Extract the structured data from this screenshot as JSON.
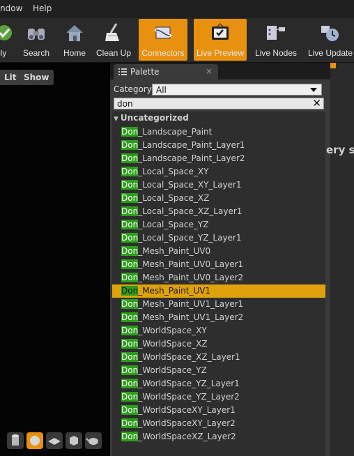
{
  "menu": {
    "items": [
      "ndow",
      "Help"
    ]
  },
  "toolbar": {
    "buttons": [
      {
        "label": "ply",
        "icon": "apply-check-icon"
      },
      {
        "label": "Search",
        "icon": "binoculars-icon"
      },
      {
        "label": "Home",
        "icon": "home-icon"
      },
      {
        "label": "Clean Up",
        "icon": "broom-icon"
      },
      {
        "label": "Connectors",
        "icon": "connectors-icon",
        "active": true
      },
      {
        "label": "Live Preview",
        "icon": "tv-icon",
        "active": true
      },
      {
        "label": "Live Nodes",
        "icon": "nodes-icon"
      },
      {
        "label": "Live Update",
        "icon": "refresh-clock-icon"
      }
    ]
  },
  "viewport": {
    "lit_label": "Lit",
    "show_label": "Show"
  },
  "palette": {
    "tab_title": "Palette",
    "close_glyph": "×",
    "category_label": "Category:",
    "category_value": "All",
    "search_value": "don",
    "clear_glyph": "✕",
    "group_label": "Uncategorized",
    "highlight": "Don",
    "items": [
      "_Landscape_Paint",
      "_Landscape_Paint_Layer1",
      "_Landscape_Paint_Layer2",
      "_Local_Space_XY",
      "_Local_Space_XY_Layer1",
      "_Local_Space_XZ",
      "_Local_Space_XZ_Layer1",
      "_Local_Space_YZ",
      "_Local_Space_YZ_Layer1",
      "_Mesh_Paint_UV0",
      "_Mesh_Paint_UV0_Layer1",
      "_Mesh_Paint_UV0_Layer2",
      "_Mesh_Paint_UV1",
      "_Mesh_Paint_UV1_Layer1",
      "_Mesh_Paint_UV1_Layer2",
      "_WorldSpace_XY",
      "_WorldSpace_XZ",
      "_WorldSpace_XZ_Layer1",
      "_WorldSpace_YZ",
      "_WorldSpace_YZ_Layer1",
      "_WorldSpace_YZ_Layer2",
      "_WorldSpaceXY_Layer1",
      "_WorldSpaceXY_Layer2",
      "_WorldSpaceXZ_Layer2"
    ],
    "selected_index": 12
  },
  "graph": {
    "partial_text": "ery s"
  },
  "colors": {
    "accent": "#e8900f",
    "match_highlight": "#2d9d1b",
    "selected_row": "#e0a20c"
  }
}
